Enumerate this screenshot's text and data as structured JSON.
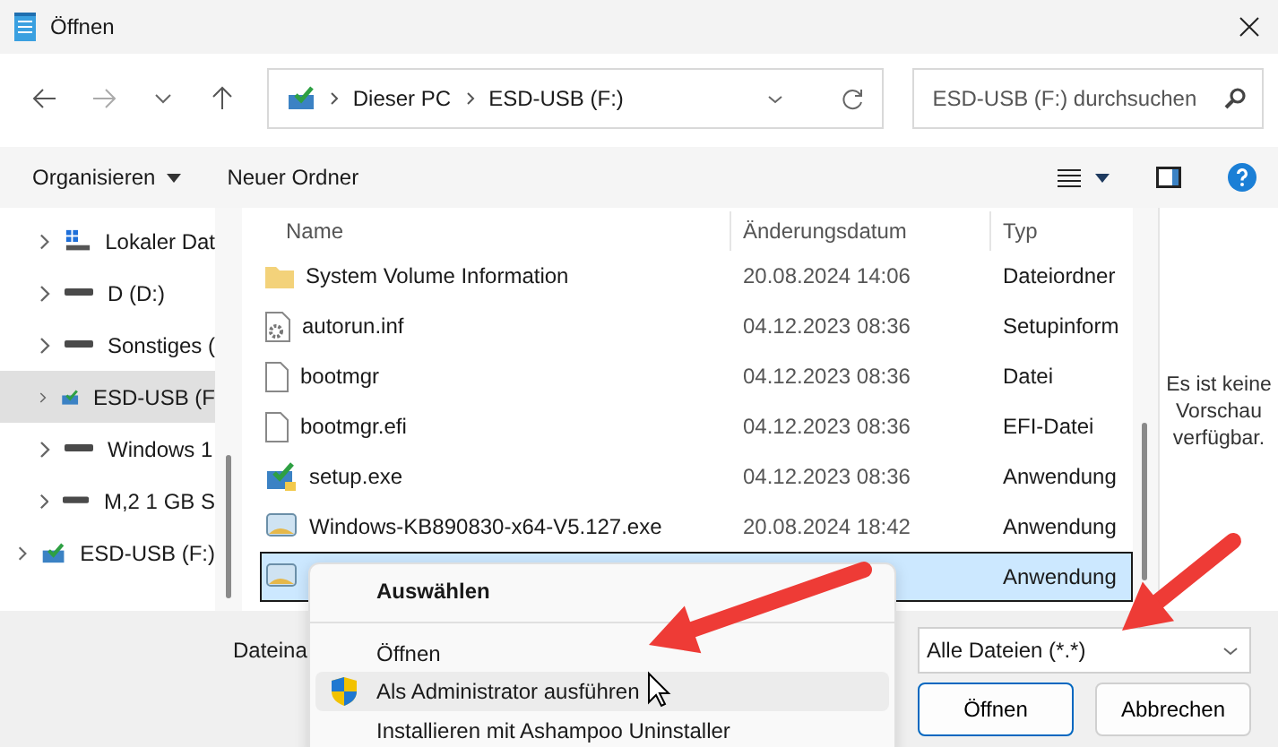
{
  "window": {
    "title": "Öffnen"
  },
  "address": {
    "segments": [
      "Dieser PC",
      "ESD-USB (F:)"
    ]
  },
  "search": {
    "placeholder": "ESD-USB (F:) durchsuchen"
  },
  "toolbar": {
    "buttons": [
      "Organisieren",
      "Neuer Ordner"
    ]
  },
  "sidebar": {
    "items": [
      {
        "label": "Lokaler Dat",
        "kind": "system",
        "selected": false
      },
      {
        "label": "D (D:)",
        "kind": "drive",
        "selected": false
      },
      {
        "label": "Sonstiges (",
        "kind": "drive",
        "selected": false
      },
      {
        "label": "ESD-USB (F",
        "kind": "usb",
        "selected": true
      },
      {
        "label": "Windows 1",
        "kind": "drive",
        "selected": false
      },
      {
        "label": "M,2 1 GB S",
        "kind": "drive",
        "selected": false
      },
      {
        "label": "ESD-USB (F:)",
        "kind": "usb-root",
        "selected": false
      }
    ]
  },
  "table": {
    "columns": [
      "Name",
      "Änderungsdatum",
      "Typ"
    ],
    "rows": [
      {
        "kind": "folder",
        "name": "System Volume Information",
        "date": "20.08.2024 14:06",
        "type": "Dateiordner",
        "selected": false
      },
      {
        "kind": "settings",
        "name": "autorun.inf",
        "date": "04.12.2023 08:36",
        "type": "Setupinform",
        "selected": false
      },
      {
        "kind": "file",
        "name": "bootmgr",
        "date": "04.12.2023 08:36",
        "type": "Datei",
        "selected": false
      },
      {
        "kind": "file",
        "name": "bootmgr.efi",
        "date": "04.12.2023 08:36",
        "type": "EFI-Datei",
        "selected": false
      },
      {
        "kind": "setup",
        "name": "setup.exe",
        "date": "04.12.2023 08:36",
        "type": "Anwendung",
        "selected": false
      },
      {
        "kind": "app",
        "name": "Windows-KB890830-x64-V5.127.exe",
        "date": "20.08.2024 18:42",
        "type": "Anwendung",
        "selected": false
      },
      {
        "kind": "app",
        "type": "Anwendung",
        "selected": true
      }
    ]
  },
  "preview": {
    "text": "Es ist keine Vorschau verfügbar."
  },
  "filename": {
    "label": "Dateina"
  },
  "filter": {
    "value": "Alle Dateien  (*.*)"
  },
  "buttons": [
    "Öffnen",
    "Abbrechen"
  ],
  "context_menu": {
    "items": [
      {
        "label": "Auswählen",
        "bold": true,
        "shield": false,
        "hovered": false,
        "separator_after": true
      },
      {
        "label": "Öffnen",
        "bold": false,
        "shield": false,
        "hovered": false,
        "separator_after": false
      },
      {
        "label": "Als Administrator ausführen",
        "bold": false,
        "shield": true,
        "hovered": true,
        "separator_after": false
      },
      {
        "label": "Installieren mit Ashampoo Uninstaller",
        "bold": false,
        "shield": false,
        "hovered": false,
        "separator_after": false
      }
    ]
  }
}
